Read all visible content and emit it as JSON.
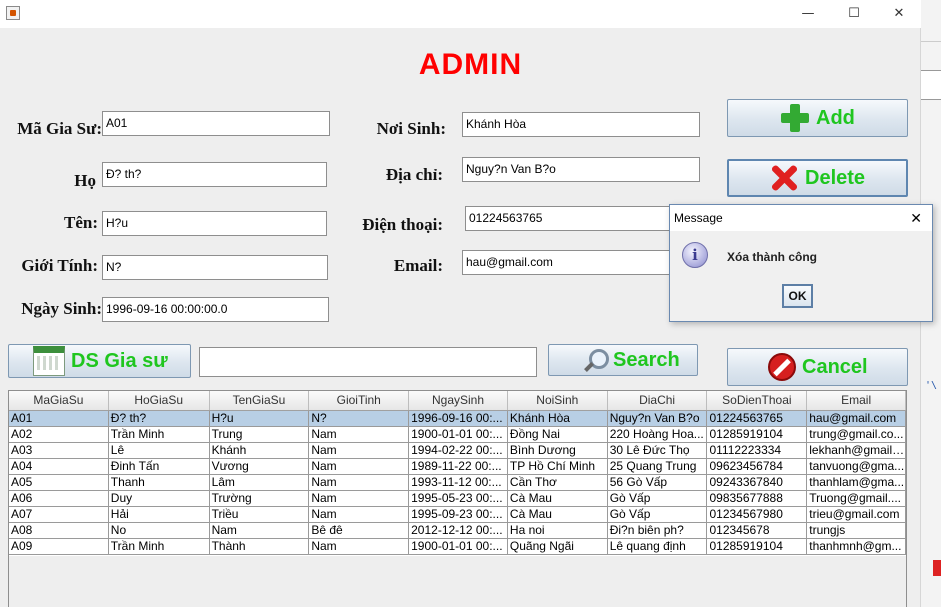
{
  "window": {
    "title": "",
    "minimize_glyph": "—",
    "maximize_glyph": "☐",
    "close_glyph": "✕"
  },
  "heading": "ADMIN",
  "form": {
    "ma_gia_su": {
      "label": "Mã Gia Sư:",
      "value": "A01"
    },
    "ho": {
      "label": "Họ",
      "value": "Đ? th?"
    },
    "ten": {
      "label": "Tên:",
      "value": "H?u"
    },
    "gioi_tinh": {
      "label": "Giới Tính:",
      "value": "N?"
    },
    "ngay_sinh": {
      "label": "Ngày Sinh:",
      "value": "1996-09-16 00:00:00.0"
    },
    "noi_sinh": {
      "label": "Nơi Sinh:",
      "value": "Khánh Hòa"
    },
    "dia_chi": {
      "label": "Địa chỉ:",
      "value": "Nguy?n Van B?o"
    },
    "dien_thoai": {
      "label": "Điện thoại:",
      "value": "01224563765"
    },
    "email": {
      "label": "Email:",
      "value": "hau@gmail.com"
    }
  },
  "buttons": {
    "add": "Add",
    "delete": "Delete",
    "cancel": "Cancel",
    "ds_gia_su": "DS Gia sư",
    "search": "Search"
  },
  "search": {
    "value": ""
  },
  "table": {
    "columns": [
      "MaGiaSu",
      "HoGiaSu",
      "TenGiaSu",
      "GioiTinh",
      "NgaySinh",
      "NoiSinh",
      "DiaChi",
      "SoDienThoai",
      "Email"
    ],
    "rows": [
      [
        "A01",
        "Đ? th?",
        "H?u",
        "N?",
        "1996-09-16 00:...",
        "Khánh Hòa",
        "Nguy?n Van B?o",
        "01224563765",
        "hau@gmail.com"
      ],
      [
        "A02",
        "Trần Minh",
        "Trung",
        "Nam",
        "1900-01-01 00:...",
        "Đồng Nai",
        "220 Hoàng Hoa...",
        "01285919104",
        "trung@gmail.co..."
      ],
      [
        "A03",
        "Lê",
        "Khánh",
        "Nam",
        "1994-02-22 00:...",
        "Bình Dương",
        "30 Lê Đức Thọ",
        "01112223334",
        "lekhanh@gmail...."
      ],
      [
        "A04",
        "Đinh Tấn",
        "Vương",
        "Nam",
        "1989-11-22 00:...",
        "TP Hồ Chí Minh",
        "25 Quang Trung",
        "09623456784",
        "tanvuong@gma..."
      ],
      [
        "A05",
        "Thanh",
        "Lâm",
        "Nam",
        "1993-11-12 00:...",
        "Cần Thơ",
        "56 Gò Vấp",
        "09243367840",
        "thanhlam@gma..."
      ],
      [
        "A06",
        "Duy",
        "Trường",
        "Nam",
        "1995-05-23 00:...",
        "Cà Mau",
        "Gò Vấp",
        "09835677888",
        "Truong@gmail...."
      ],
      [
        "A07",
        "Hải",
        "Triều",
        "Nam",
        "1995-09-23 00:...",
        "Cà Mau",
        "Gò Vấp",
        "01234567980",
        "trieu@gmail.com"
      ],
      [
        "A08",
        "No",
        "Nam",
        "Bê đê",
        "2012-12-12 00:...",
        "Ha noi",
        "Đi?n biên ph?",
        "012345678",
        "trungjs"
      ],
      [
        "A09",
        "Trần Minh",
        "Thành",
        "Nam",
        "1900-01-01 00:...",
        "Quãng Ngãi",
        "Lê quang định",
        "01285919104",
        "thanhmnh@gm..."
      ]
    ],
    "selected_index": 0
  },
  "dialog": {
    "title": "Message",
    "close_glyph": "✕",
    "icon_glyph": "i",
    "message": "Xóa thành công",
    "ok_label": "OK"
  },
  "background_fragment": "'\\"
}
